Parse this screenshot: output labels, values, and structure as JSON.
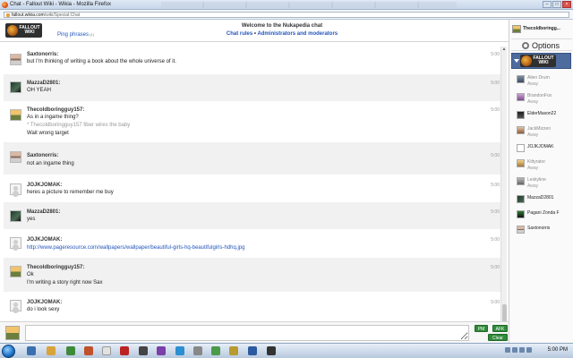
{
  "window": {
    "title": "Chat - Fallout Wiki - Wikia - Mozilla Firefox",
    "url_domain": "fallout.wikia.com",
    "url_path": "/wiki/Special:Chat",
    "url_prefix": "http://"
  },
  "header": {
    "logo_text": "FALLOUT WIKI",
    "ping_label": "Ping phrases",
    "ping_count": "(1)",
    "welcome": "Welcome to the Nukapedia chat",
    "link_rules": "Chat rules",
    "link_separator": "•",
    "link_admins": "Administrators and moderators"
  },
  "messages": [
    {
      "author": "Saxtonorris:",
      "lines": [
        "but I'm thinking of writing a book about the whole universe of it."
      ],
      "time": "5:00",
      "avatar": "saxtonorris"
    },
    {
      "author": "MazzaD2801:",
      "lines": [
        "OH YEAH"
      ],
      "time": "5:00",
      "avatar": "mazzad2801"
    },
    {
      "author": "Thecoldboringguy157:",
      "lines": [
        "As in a ingame thing?",
        "* Thecoldboringguy157 fiber wires the baby",
        "Wait wrong target"
      ],
      "time": "5:00",
      "avatar": "thecoldboringguy157"
    },
    {
      "author": "Saxtonorris:",
      "lines": [
        "not an ingame thing"
      ],
      "time": "5:00",
      "avatar": "saxtonorris"
    },
    {
      "author": "JOJKJOMAK:",
      "lines": [
        "heres a picture to remember me buy"
      ],
      "time": "5:00",
      "avatar": "jojkjomak"
    },
    {
      "author": "MazzaD2801:",
      "lines": [
        "yes"
      ],
      "time": "5:00",
      "avatar": "mazzad2801"
    },
    {
      "author": "JOJKJOMAK:",
      "lines": [
        "http://www.pageresource.com/wallpapers/wallpaper/beautiful-girls-hq-beautifulgirls-hdhq.jpg"
      ],
      "time": "5:00",
      "avatar": "jojkjomak"
    },
    {
      "author": "Thecoldboringguy157:",
      "lines": [
        "Ok",
        "I'm writing a story right now Sax"
      ],
      "time": "5:00",
      "avatar": "thecoldboringguy157"
    },
    {
      "author": "JOJKJOMAK:",
      "lines": [
        "do i look sexy"
      ],
      "time": "5:00",
      "avatar": "jojkjomak"
    }
  ],
  "input": {
    "value": "",
    "pm_label": "PM",
    "afk_label": "AFK",
    "clear_label": "Clear"
  },
  "sidebar": {
    "current_user": "Thecoldboringg...",
    "options_label": "Options",
    "room_logo_text": "FALLOUT WIKI",
    "users": [
      {
        "name": "Alien Drum",
        "status": "Away"
      },
      {
        "name": "BrandonFox",
        "status": "Away"
      },
      {
        "name": "ElderMaxon22",
        "status": ""
      },
      {
        "name": "JackMizzen",
        "status": "Away"
      },
      {
        "name": "JOJKJOMAK",
        "status": ""
      },
      {
        "name": "Kittyrator",
        "status": "Away"
      },
      {
        "name": "Leskyline",
        "status": "Away"
      },
      {
        "name": "MazzaD2801",
        "status": ""
      },
      {
        "name": "Pagani Zonda F",
        "status": ""
      },
      {
        "name": "Saxtonorris",
        "status": ""
      }
    ]
  },
  "taskbar": {
    "clock": "5:00 PM"
  }
}
